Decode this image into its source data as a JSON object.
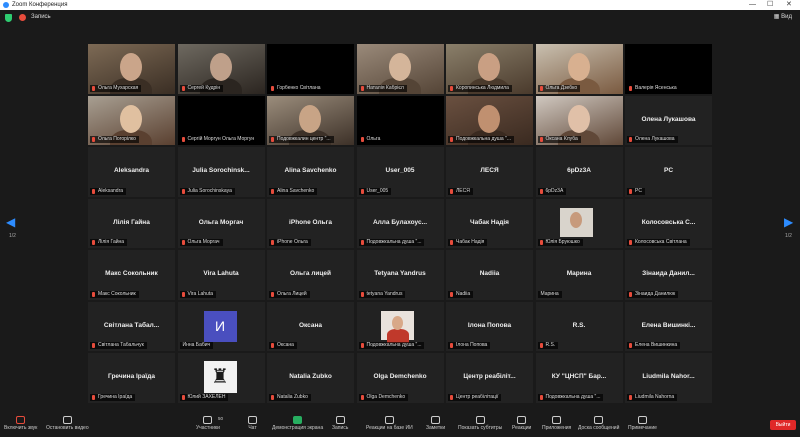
{
  "window": {
    "title": "Zoom Конференция"
  },
  "topbar": {
    "recording_label": "Запись",
    "view_label": "Вид"
  },
  "pager": {
    "left": "1/2",
    "right": "1/2"
  },
  "tiles": [
    {
      "label": "Ольга Мухарская",
      "kind": "video",
      "active": true
    },
    {
      "label": "Сергей Кудрін",
      "kind": "video"
    },
    {
      "label": "Горбенко Світлана",
      "kind": "dark"
    },
    {
      "label": "Наталія Кабрієл",
      "kind": "video"
    },
    {
      "label": "Коропинська Людмила",
      "kind": "video"
    },
    {
      "label": "Ольга Дзебко",
      "kind": "video"
    },
    {
      "label": "Валерія Ясенська",
      "kind": "dark"
    },
    {
      "label": "Ольга Погорілко",
      "kind": "video"
    },
    {
      "label": "Сергій Моргун Ольга Моргун",
      "kind": "dark"
    },
    {
      "label": "Подовжкалин центр \"...",
      "kind": "video"
    },
    {
      "label": "Ольга",
      "kind": "dark"
    },
    {
      "label": "Подовжкальна душа \"...",
      "kind": "video"
    },
    {
      "label": "Оксана Клуба",
      "kind": "video"
    },
    {
      "center": "Олена Лукашова",
      "label": "Олена Лукашова",
      "kind": "name"
    },
    {
      "center": "Aleksandra",
      "label": "Aleksandra",
      "kind": "name"
    },
    {
      "center": "Julia Sorochinsk...",
      "label": "Julia Sorochinskaya",
      "kind": "name"
    },
    {
      "center": "Alina Savchenko",
      "label": "Alina Savchenko",
      "kind": "name"
    },
    {
      "center": "User_005",
      "label": "User_005",
      "kind": "name"
    },
    {
      "center": "ЛЕСЯ",
      "label": "ЛЕСЯ",
      "kind": "name"
    },
    {
      "center": "6pDz3A",
      "label": "6pDz3A",
      "kind": "name"
    },
    {
      "center": "PC",
      "label": "PC",
      "kind": "name"
    },
    {
      "center": "Лілія Гайна",
      "label": "Лілія Гайна",
      "kind": "name"
    },
    {
      "center": "Ольга Моргач",
      "label": "Ольга Моргач",
      "kind": "name"
    },
    {
      "center": "iPhone Ольга",
      "label": "iPhone Ольга",
      "kind": "name"
    },
    {
      "center": "Алла Булахоус...",
      "label": "Подовжкальна душа \"...",
      "kind": "name"
    },
    {
      "center": "Чабак Надія",
      "label": "Чабак Надія",
      "kind": "name"
    },
    {
      "label": "Юлія Бруюшко",
      "kind": "photo"
    },
    {
      "center": "Колосовська С...",
      "label": "Колосовська Світлана",
      "kind": "name"
    },
    {
      "center": "Макс Сокольник",
      "label": "Макс Сокольник",
      "kind": "name"
    },
    {
      "center": "Vira Lahuta",
      "label": "Vira Lahuta",
      "kind": "name"
    },
    {
      "center": "Ольга лицей",
      "label": "Ольга Лицей",
      "kind": "name"
    },
    {
      "center": "Tetyana Yandrus",
      "label": "tetyana Yandrus",
      "kind": "name"
    },
    {
      "center": "Nadiia",
      "label": "Nadiia",
      "kind": "name"
    },
    {
      "center": "Марина",
      "label": "Марина",
      "kind": "name",
      "nomic": true
    },
    {
      "center": "Зінаида Данил...",
      "label": "Зінаида Данилюк",
      "kind": "name"
    },
    {
      "center": "Світлана Табал...",
      "label": "Світлана Табальчук",
      "kind": "name"
    },
    {
      "label": "Инна Бабич",
      "kind": "letter",
      "letter": "И",
      "nomic": true
    },
    {
      "center": "Оксана",
      "label": "Оксана",
      "kind": "name"
    },
    {
      "label": "Подовжкальна душа \"...",
      "kind": "photo2"
    },
    {
      "center": "Ілона Попова",
      "label": "Ілона Попова",
      "kind": "name"
    },
    {
      "center": "R.S.",
      "label": "R.S.",
      "kind": "name"
    },
    {
      "center": "Елена Вишинкі...",
      "label": "Елена Вишинкина",
      "kind": "name"
    },
    {
      "center": "Гречина Іраїда",
      "label": "Гречина Іраїда",
      "kind": "name"
    },
    {
      "label": "Юлий ЗАХЕЛЕН",
      "kind": "emblem"
    },
    {
      "center": "Natalia Zubko",
      "label": "Natalia Zubko",
      "kind": "name"
    },
    {
      "center": "Olga Demchenko",
      "label": "Olga Demchenko",
      "kind": "name"
    },
    {
      "center": "Центр реабіліт...",
      "label": "Центр реабілітації",
      "kind": "name"
    },
    {
      "center": "КУ \"ЦНСП\" Бар...",
      "label": "Подовжкальна душа \"...",
      "kind": "name"
    },
    {
      "center": "Liudmila Nahor...",
      "label": "Liudmila Nahorna",
      "kind": "name"
    }
  ],
  "toolbar": {
    "items": [
      {
        "label": "Включить звук",
        "icon": "microphone-muted-icon"
      },
      {
        "label": "Остановить видео",
        "icon": "video-camera-icon"
      },
      {
        "label": "Участники",
        "icon": "participants-icon",
        "badge": "50"
      },
      {
        "label": "Чат",
        "icon": "chat-icon"
      },
      {
        "label": "Демонстрация экрана",
        "icon": "share-screen-icon"
      },
      {
        "label": "Запись",
        "icon": "record-icon"
      },
      {
        "label": "Реакции на базе ИИ",
        "icon": "ai-reactions-icon"
      },
      {
        "label": "Заметки",
        "icon": "notes-icon"
      },
      {
        "label": "Показать субтитры",
        "icon": "captions-icon"
      },
      {
        "label": "Реакции",
        "icon": "reactions-icon"
      },
      {
        "label": "Приложения",
        "icon": "apps-icon"
      },
      {
        "label": "Доска сообщений",
        "icon": "whiteboard-icon"
      },
      {
        "label": "Примечание",
        "icon": "note-icon"
      }
    ],
    "end_label": "Выйти"
  },
  "colors": {
    "accent": "#2d8cff",
    "active_speaker": "#d6e23a",
    "muted": "#e74c3c",
    "share": "#27ae60",
    "end": "#e02828"
  }
}
